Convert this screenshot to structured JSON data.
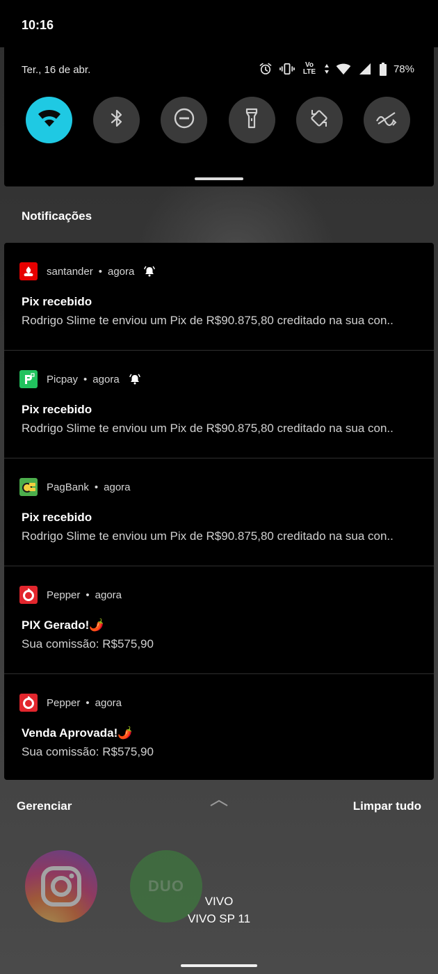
{
  "status_bar": {
    "time": "10:16"
  },
  "quick_settings": {
    "date": "Ter., 16 de abr.",
    "battery_percent": "78%",
    "network_label_top": "Vo",
    "network_label_bottom": "LTE",
    "tiles": [
      {
        "icon": "wifi-icon",
        "active": true
      },
      {
        "icon": "bluetooth-icon",
        "active": false
      },
      {
        "icon": "do-not-disturb-icon",
        "active": false
      },
      {
        "icon": "flashlight-icon",
        "active": false
      },
      {
        "icon": "auto-rotate-icon",
        "active": false
      },
      {
        "icon": "data-saver-icon",
        "active": false
      }
    ]
  },
  "notifications": {
    "header": "Notificações",
    "items": [
      {
        "app": "santander",
        "time": "agora",
        "alerting": true,
        "title": "Pix recebido",
        "body": "Rodrigo Slime te enviou um Pix de R$90.875,80 creditado na sua con..",
        "icon_color": "#e60000"
      },
      {
        "app": "Picpay",
        "time": "agora",
        "alerting": true,
        "title": "Pix recebido",
        "body": "Rodrigo Slime te enviou um Pix de R$90.875,80 creditado na sua con..",
        "icon_color": "#21c25e"
      },
      {
        "app": "PagBank",
        "time": "agora",
        "alerting": false,
        "title": "Pix recebido",
        "body": "Rodrigo Slime te enviou um Pix de R$90.875,80 creditado na sua con..",
        "icon_color": "#4cae4c"
      },
      {
        "app": "Pepper",
        "time": "agora",
        "alerting": false,
        "title": "PIX Gerado!🌶️",
        "body": "Sua comissão: R$575,90",
        "icon_color": "#e2262d"
      },
      {
        "app": "Pepper",
        "time": "agora",
        "alerting": false,
        "title": "Venda Aprovada!🌶️",
        "body": "Sua comissão: R$575,90",
        "icon_color": "#e2262d"
      }
    ]
  },
  "actions": {
    "manage_label": "Gerenciar",
    "clear_label": "Limpar tudo"
  },
  "home": {
    "duo_label": "DUO",
    "carrier_line1": "VIVO",
    "carrier_line2": "VIVO SP 11"
  }
}
